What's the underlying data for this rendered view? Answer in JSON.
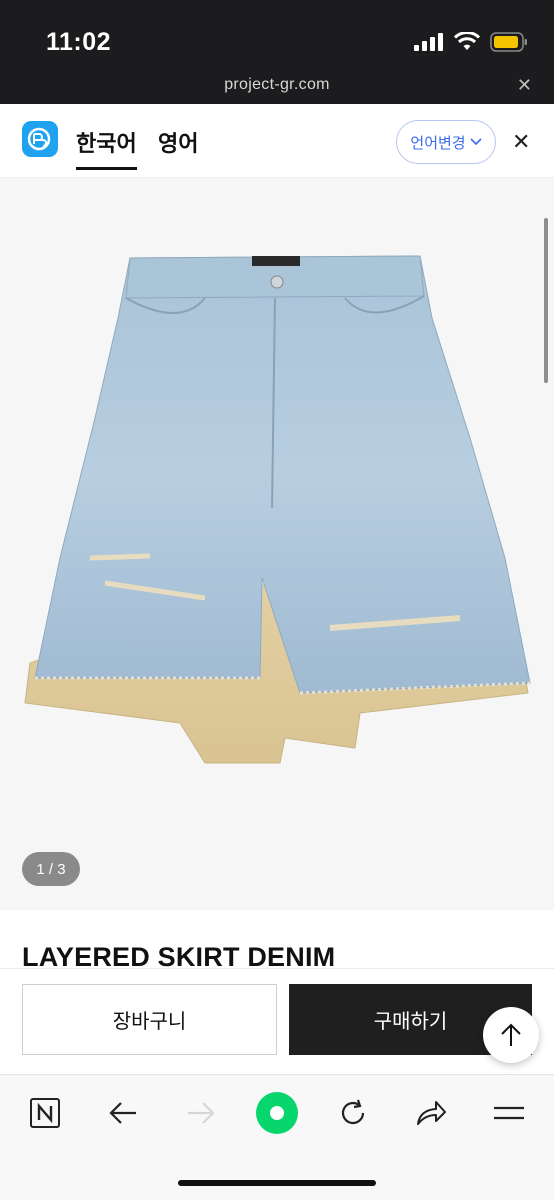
{
  "status_bar": {
    "time": "11:02"
  },
  "url_bar": {
    "domain": "project-gr.com"
  },
  "translate_bar": {
    "tabs": [
      {
        "label": "한국어",
        "active": true
      },
      {
        "label": "영어",
        "active": false
      }
    ],
    "change_language_label": "언어변경"
  },
  "product": {
    "image_counter": "1 / 3",
    "title": "LAYERED SKIRT DENIM"
  },
  "actions": {
    "cart_label": "장바구니",
    "buy_label": "구매하기"
  },
  "browser_toolbar": {
    "items": [
      "naver-icon",
      "back-icon",
      "forward-icon",
      "home-icon",
      "refresh-icon",
      "share-icon",
      "menu-icon"
    ]
  },
  "colors": {
    "accent_blue": "#3b6cf0",
    "logo_blue": "#1fa2f0",
    "home_green": "#06d66b",
    "buy_button": "#1f1f1f"
  }
}
